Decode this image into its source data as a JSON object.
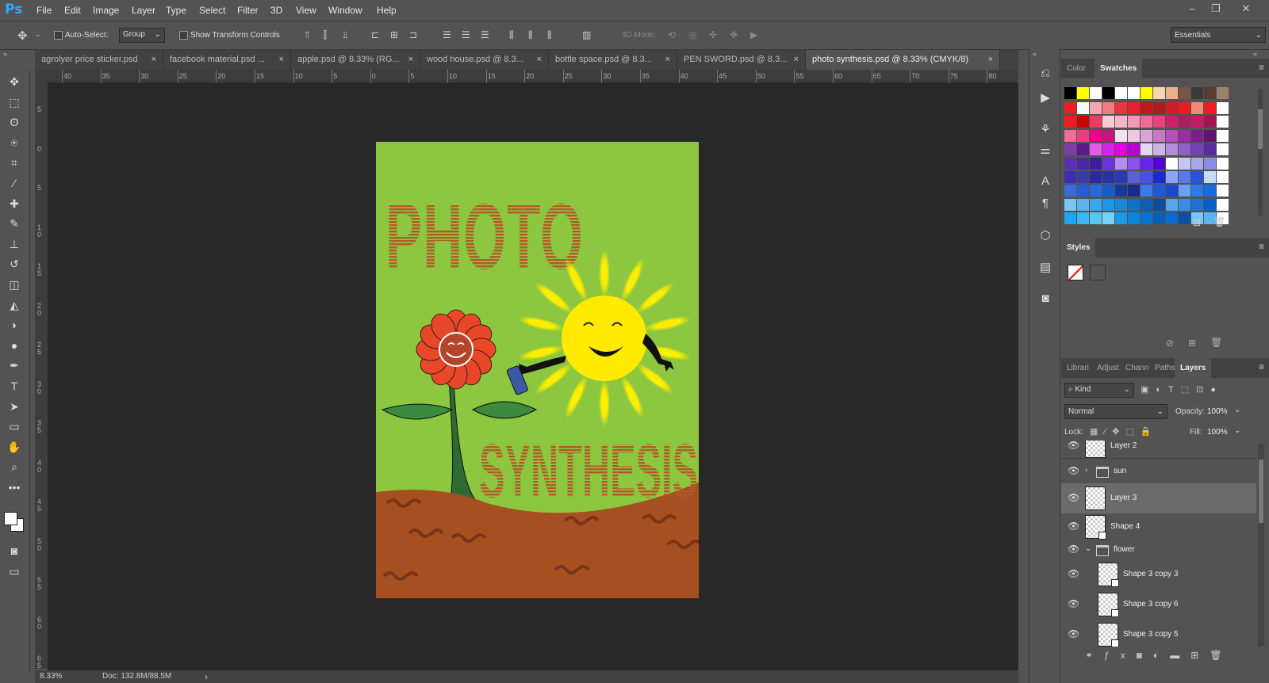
{
  "app": {
    "logo": "Ps",
    "accent": "#31a8ff"
  },
  "menu": [
    "File",
    "Edit",
    "Image",
    "Layer",
    "Type",
    "Select",
    "Filter",
    "3D",
    "View",
    "Window",
    "Help"
  ],
  "window_controls": [
    "minimize-icon",
    "restore-icon",
    "close-icon"
  ],
  "options": {
    "auto_select_label": "Auto-Select:",
    "auto_select_value": "Group",
    "transform_label": "Show Transform Controls",
    "mode_label": "3D Mode:",
    "workspace": "Essentials"
  },
  "tabs": [
    {
      "label": "agrolyer price sticker.psd",
      "close": "×"
    },
    {
      "label": "facebook material.psd ...",
      "close": "×"
    },
    {
      "label": "apple.psd @ 8.33% (RG...",
      "close": "×"
    },
    {
      "label": "wood house.psd @ 8.3...",
      "close": "×"
    },
    {
      "label": "bottle space.psd @ 8.3...",
      "close": "×"
    },
    {
      "label": "PEN SWORD.psd @ 8.3...",
      "close": "×"
    },
    {
      "label": "photo synthesis.psd @ 8.33% (CMYK/8)",
      "close": "×"
    }
  ],
  "ruler_top": [
    "40",
    "35",
    "30",
    "25",
    "20",
    "15",
    "10",
    "5",
    "0",
    "5",
    "10",
    "15",
    "20",
    "25",
    "30",
    "35",
    "40",
    "45",
    "50",
    "55",
    "60",
    "65",
    "70",
    "75",
    "80"
  ],
  "ruler_left": [
    "5",
    "0",
    "5",
    "10",
    "15",
    "20",
    "25",
    "30",
    "35",
    "40",
    "45",
    "50",
    "55",
    "60",
    "65"
  ],
  "artwork": {
    "title_top": "PHOTO",
    "title_bottom": "SYNTHESIS",
    "bg_color": "#8dc63f",
    "ground_color": "#a65022",
    "title_color": "#b3562a",
    "sun_color": "#ffea00",
    "flower_color": "#e8472a"
  },
  "status": {
    "zoom": "8.33%",
    "doc": "Doc: 132.8M/88.5M",
    "arrow": "›"
  },
  "panels": {
    "color_tabs": [
      "Color",
      "Swatches"
    ],
    "styles_tab": "Styles",
    "layers_tabs": [
      "Librari",
      "Adjust",
      "Chann",
      "Paths",
      "Layers"
    ],
    "filter_kind": "Kind",
    "blend_mode": "Normal",
    "opacity_label": "Opacity:",
    "opacity_value": "100%",
    "lock_label": "Lock:",
    "fill_label": "Fill:",
    "fill_value": "100%"
  },
  "layers": [
    {
      "name": "Layer 2",
      "type": "layer"
    },
    {
      "name": "sun",
      "type": "group",
      "expanded": false
    },
    {
      "name": "Layer 3",
      "type": "layer",
      "selected": true
    },
    {
      "name": "Shape 4",
      "type": "shape"
    },
    {
      "name": "flower",
      "type": "group",
      "expanded": true
    },
    {
      "name": "Shape 3 copy 3",
      "type": "shape",
      "indent": true
    },
    {
      "name": "Shape 3 copy 6",
      "type": "shape",
      "indent": true
    },
    {
      "name": "Shape 3 copy 5",
      "type": "shape",
      "indent": true
    }
  ],
  "swatch_rows": [
    [
      "#000000",
      "#ffff00",
      "#ffffff",
      "#000000",
      "#ffffff",
      "#ffffff",
      "#ffff00",
      "#f5d6b0",
      "#e6b48c",
      "#7a5446",
      "#3a3a3a",
      "#5a3c32",
      "#9a8270"
    ],
    [
      "#ed1c24",
      "#f9f9f9",
      "#f6a6b0",
      "#f07c80",
      "#ee3340",
      "#e91e2e",
      "#c2161e",
      "#ad1a20",
      "#d11e26",
      "#ed1c24",
      "#f08a72",
      "#ed1c24",
      "#ffffff"
    ],
    [
      "#ed1c24",
      "#cc0000",
      "#ed3b62",
      "#f9ccd8",
      "#f6b6c8",
      "#f49ab8",
      "#f06c98",
      "#ec3f7e",
      "#c8226a",
      "#a81f5e",
      "#c71a68",
      "#9e1552",
      "#ffffff"
    ],
    [
      "#f26d9c",
      "#ee3b82",
      "#ec008c",
      "#c8157e",
      "#f5e2f0",
      "#f0c8e4",
      "#dca4d4",
      "#c879c6",
      "#b64fb6",
      "#9b2ea0",
      "#7d1e8a",
      "#5f1472",
      "#ffffff"
    ],
    [
      "#7b3fa0",
      "#5a1a8a",
      "#e05ce8",
      "#d726e8",
      "#e600e6",
      "#ba00d4",
      "#e2d4f2",
      "#cdb4e8",
      "#b08ed8",
      "#9160c8",
      "#7440b6",
      "#5a2c9c",
      "#ffffff"
    ],
    [
      "#5a2fb6",
      "#4a2a9e",
      "#3d1e9a",
      "#6a34d8",
      "#b68cf0",
      "#8a52f0",
      "#6a22f0",
      "#5000e0",
      "#ffffff",
      "#c6c6f4",
      "#a8a8ec",
      "#8c8ce4",
      "#ffffff"
    ],
    [
      "#3d2eb0",
      "#3a3aa6",
      "#2a2a9a",
      "#2832a2",
      "#2a3ab2",
      "#5a60d6",
      "#4a50e6",
      "#1a2ad0",
      "#8aa6f0",
      "#5a7ae6",
      "#2a52e0",
      "#c4dcf8",
      "#ffffff"
    ],
    [
      "#3a6ad8",
      "#2a5ad8",
      "#2a68dc",
      "#1a5ac8",
      "#1a3a9a",
      "#1a2a8a",
      "#3a7ae8",
      "#1a5ad8",
      "#1a4ac8",
      "#6aa0f0",
      "#2a7ae8",
      "#1a6ae0",
      "#ffffff"
    ],
    [
      "#7ac6f4",
      "#5ab4f0",
      "#3aa6ec",
      "#1a96e4",
      "#1a86dc",
      "#0e72c8",
      "#0e5eb4",
      "#0e4c9e",
      "#5aa4ec",
      "#3a8ce4",
      "#1a74d8",
      "#0a5ec8",
      "#ffffff"
    ],
    [
      "#1aa6f0",
      "#3ab6f4",
      "#5ac6f6",
      "#7ad2f8",
      "#1a9ae8",
      "#0a86dc",
      "#0a72cc",
      "#0a5eb8",
      "#0a6ad0",
      "#0a52a0",
      "#7ac6f6",
      "#5ab4f0",
      "#ffffff"
    ]
  ]
}
